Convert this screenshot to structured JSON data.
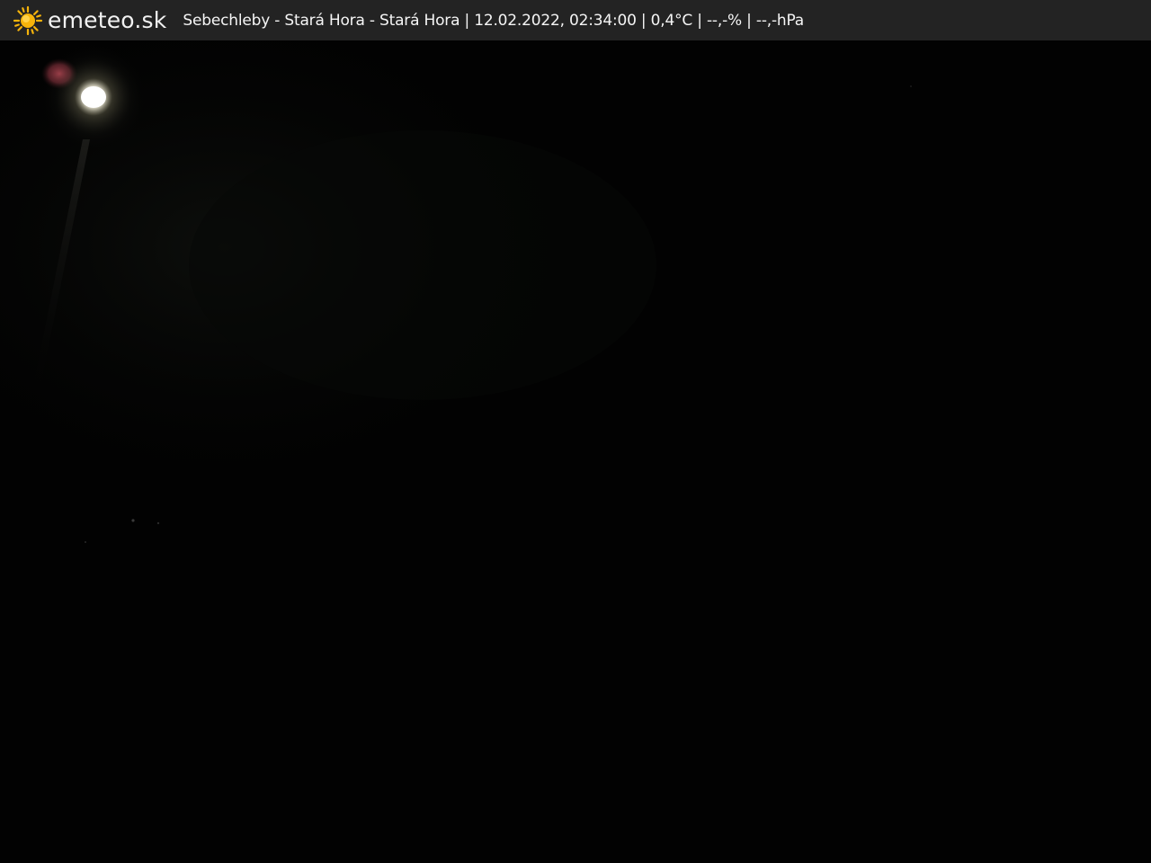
{
  "header": {
    "brand": "emeteo.sk",
    "logo_icon": "sun-icon",
    "location": "Sebechleby - Stará Hora - Stará Hora",
    "timestamp": "12.02.2022, 02:34:00",
    "temperature": "0,4°C",
    "humidity": "--,-%",
    "pressure": "--,-hPa",
    "caption": "Sebechleby - Stará Hora - Stará Hora | 12.02.2022, 02:34:00 | 0,4°C | --,-% | --,-hPa"
  },
  "scene": {
    "description_icon": "night-webcam-image",
    "colors": {
      "sky": "#020202",
      "lamp_light": "#ffffff",
      "lens_flare": "#b8424f",
      "header_bg": "#232323",
      "sun_yellow": "#f6b40b"
    }
  }
}
